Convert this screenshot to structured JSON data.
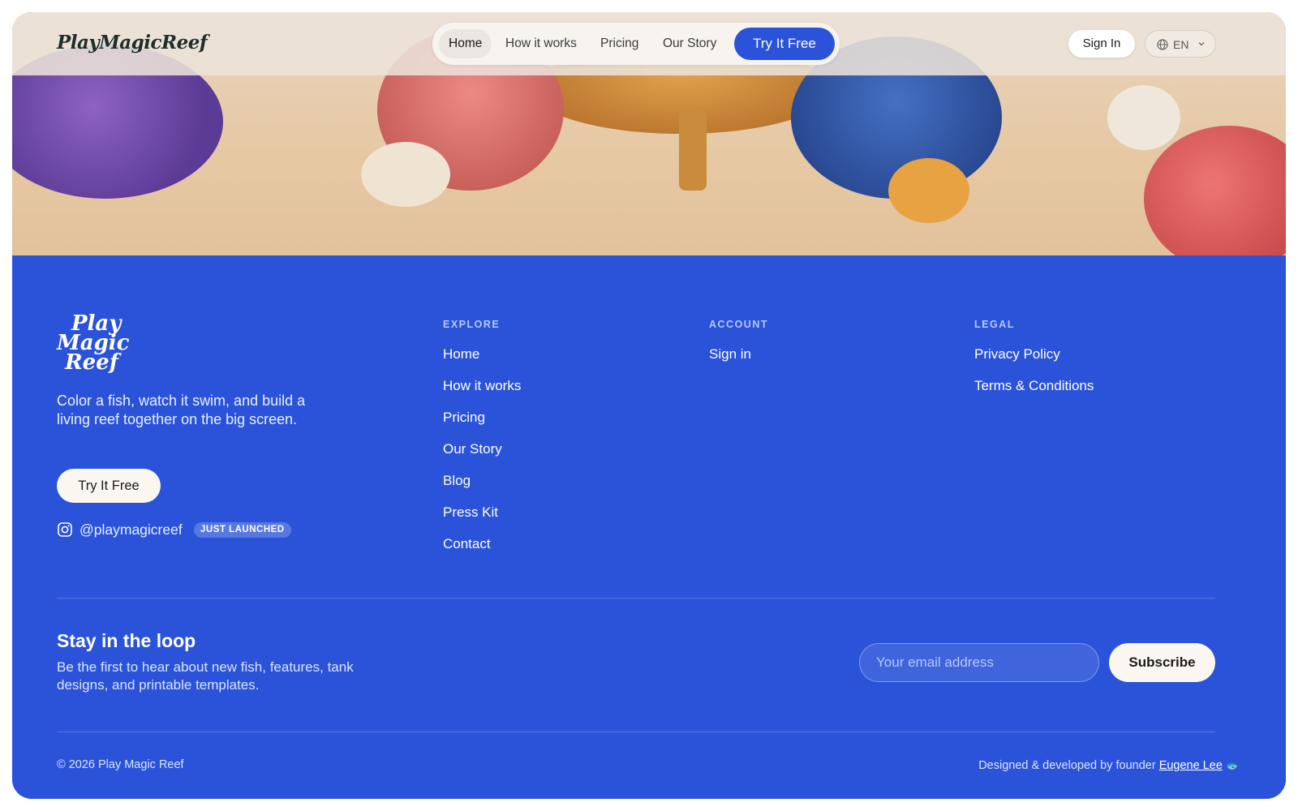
{
  "nav": {
    "brand": "PlayMagicReef",
    "items": [
      "Home",
      "How it works",
      "Pricing",
      "Our Story"
    ],
    "cta": "Try It Free",
    "sign_in": "Sign In",
    "language": "EN"
  },
  "footer": {
    "logo_lines": [
      "Play",
      "Magic",
      "Reef"
    ],
    "tagline": "Color a fish, watch it swim, and build a living reef together on the big screen.",
    "cta": "Try It Free",
    "instagram_handle": "@playmagicreef",
    "badge": "JUST LAUNCHED",
    "explore": {
      "heading": "EXPLORE",
      "links": [
        "Home",
        "How it works",
        "Pricing",
        "Our Story",
        "Blog",
        "Press Kit",
        "Contact"
      ]
    },
    "account": {
      "heading": "ACCOUNT",
      "links": [
        "Sign in"
      ]
    },
    "legal": {
      "heading": "LEGAL",
      "links": [
        "Privacy Policy",
        "Terms & Conditions"
      ]
    },
    "newsletter": {
      "title": "Stay in the loop",
      "description": "Be the first to hear about new fish, features, tank designs, and printable templates.",
      "placeholder": "Your email address",
      "button": "Subscribe"
    },
    "copyright": "© 2026 Play Magic Reef",
    "credit_prefix": "Designed & developed by founder",
    "founder": "Eugene Lee"
  },
  "colors": {
    "brand_blue": "#2a53d9",
    "cream": "#fbf7f0"
  }
}
